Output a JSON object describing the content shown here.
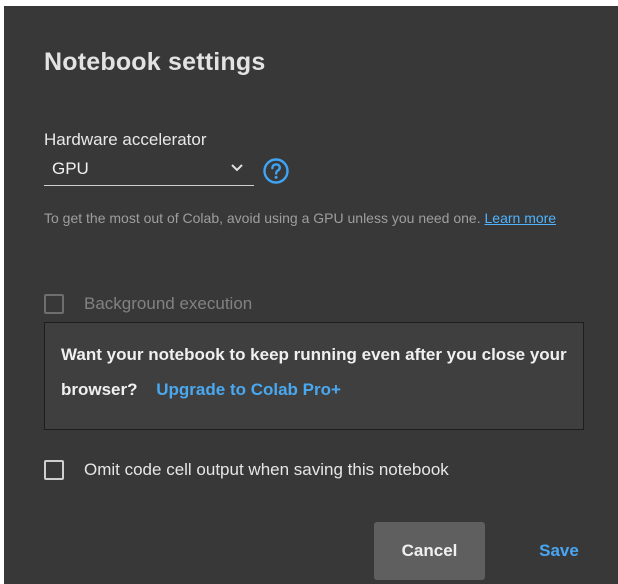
{
  "dialog": {
    "title": "Notebook settings",
    "hardware": {
      "label": "Hardware accelerator",
      "selected": "GPU"
    },
    "description": {
      "text": "To get the most out of Colab, avoid using a GPU unless you need one.",
      "link": "Learn more"
    },
    "background_execution": {
      "label": "Background execution",
      "checked": false,
      "disabled": true
    },
    "upgrade": {
      "text": "Want your notebook to keep running even after you close your browser?",
      "link": "Upgrade to Colab Pro+"
    },
    "omit_output": {
      "label": "Omit code cell output when saving this notebook",
      "checked": false
    },
    "buttons": {
      "cancel": "Cancel",
      "save": "Save"
    }
  },
  "colors": {
    "background": "#383838",
    "link": "#4aa8f0",
    "help_icon": "#3fa4f5"
  },
  "icons": {
    "select_caret": "chevron-down-icon",
    "help": "help-circle-icon"
  }
}
